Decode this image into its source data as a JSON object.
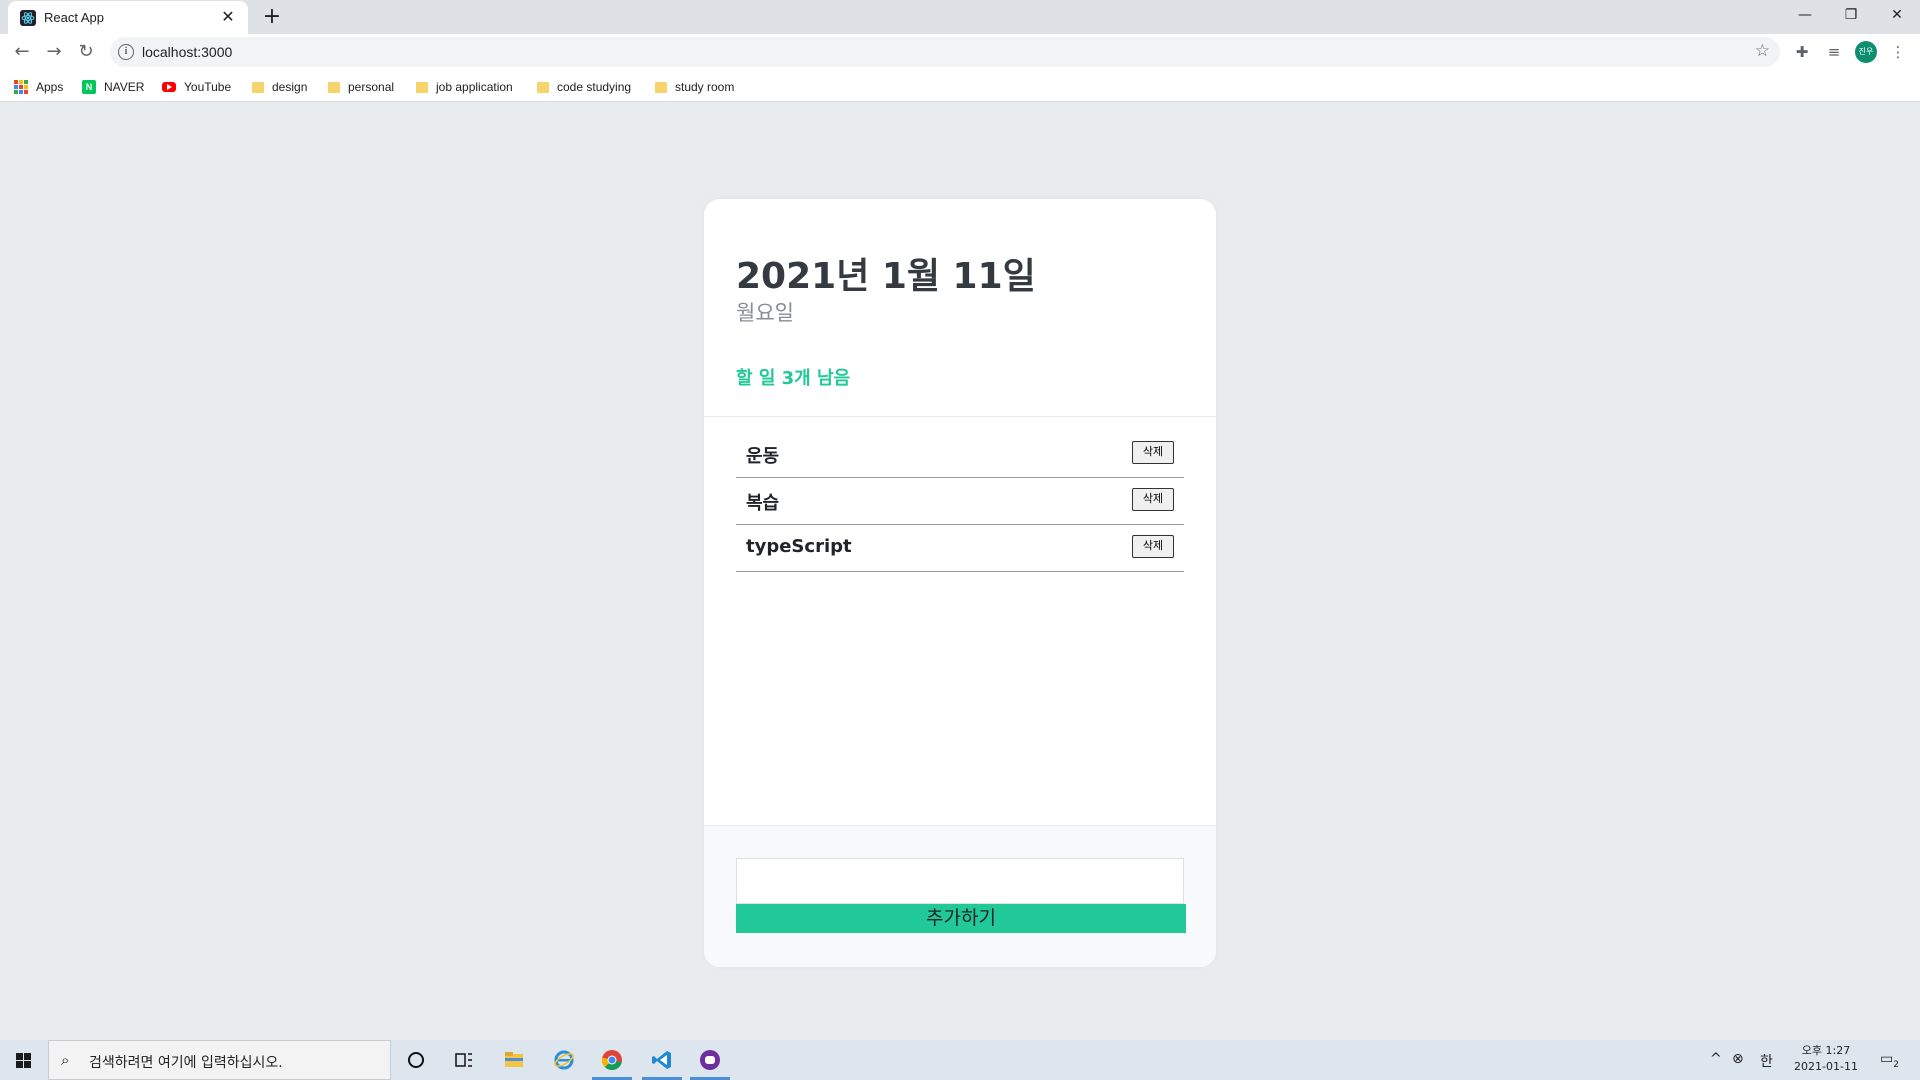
{
  "browser": {
    "tab_title": "React App",
    "url": "localhost:3000",
    "bookmarks": [
      "Apps",
      "NAVER",
      "YouTube",
      "design",
      "personal",
      "job application",
      "code studying",
      "study room"
    ],
    "profile_initials": "진우"
  },
  "todo": {
    "date": "2021년 1월 11일",
    "day": "월요일",
    "tasks_left": "할 일 3개 남음",
    "items": [
      {
        "text": "운동",
        "delete_label": "삭제"
      },
      {
        "text": "복습",
        "delete_label": "삭제"
      },
      {
        "text": "typeScript",
        "delete_label": "삭제"
      }
    ],
    "input_value": "",
    "add_button_label": "추가하기",
    "accent_color": "#20c997"
  },
  "taskbar": {
    "search_placeholder": "검색하려면 여기에 입력하십시오.",
    "ime_label": "한",
    "time": "오후 1:27",
    "date": "2021-01-11",
    "notification_count": "2"
  }
}
